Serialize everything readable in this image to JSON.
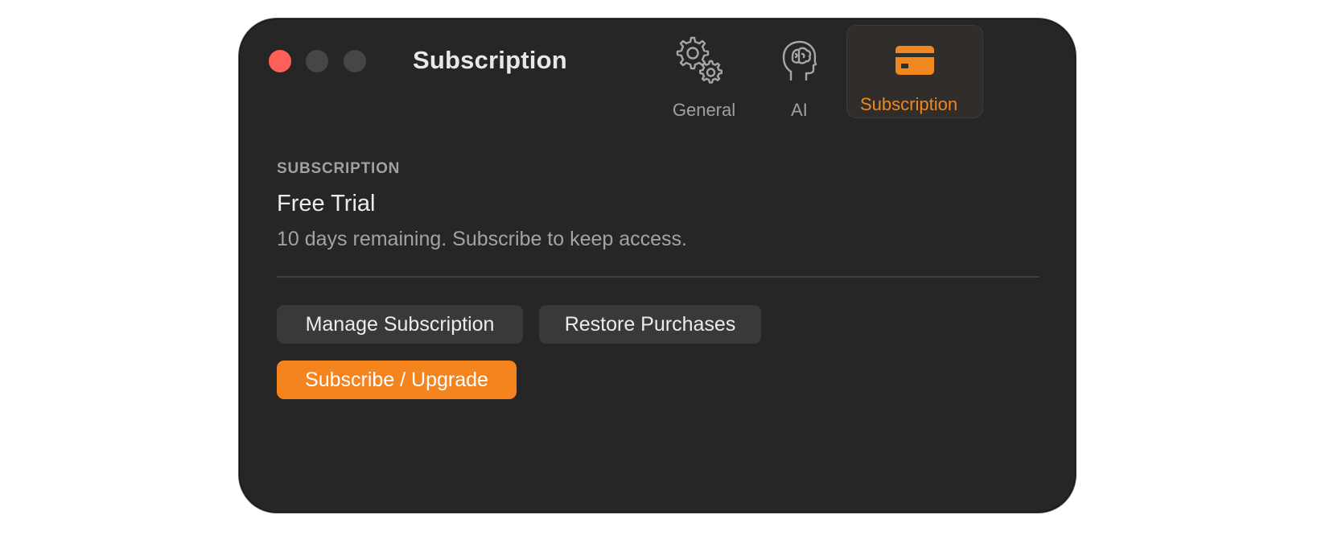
{
  "window": {
    "title": "Subscription",
    "traffic_lights": {
      "close_color": "#fe5f57",
      "inactive_color": "#474647"
    }
  },
  "toolbar": {
    "tabs": [
      {
        "label": "General",
        "icon": "gears-icon",
        "selected": false
      },
      {
        "label": "AI",
        "icon": "brain-head-icon",
        "selected": false
      },
      {
        "label": "Subscription",
        "icon": "credit-card-icon",
        "selected": true
      }
    ],
    "accent_color": "#f0871f"
  },
  "subscription": {
    "section_header": "SUBSCRIPTION",
    "plan_name": "Free Trial",
    "description": "10 days remaining. Subscribe to keep access."
  },
  "actions": {
    "manage_label": "Manage Subscription",
    "restore_label": "Restore Purchases",
    "subscribe_label": "Subscribe / Upgrade"
  }
}
